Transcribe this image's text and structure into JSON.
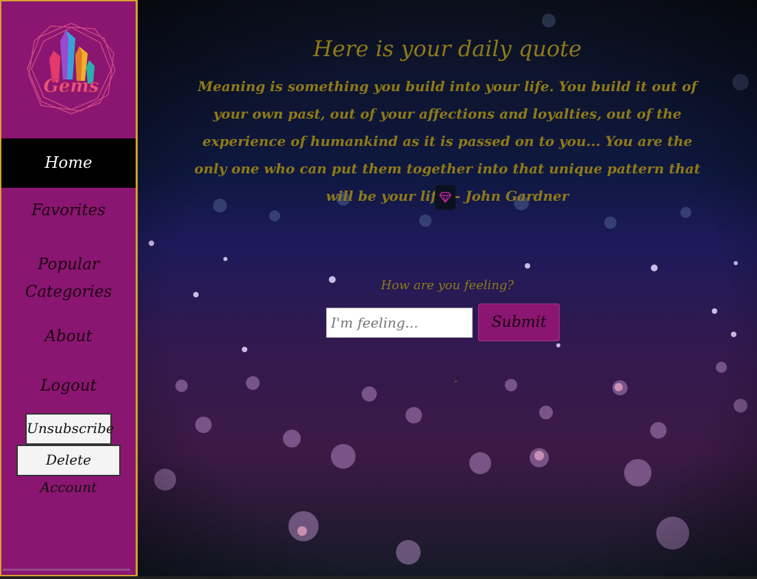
{
  "sidebar": {
    "logo_text": "Gems",
    "nav": {
      "home": "Home",
      "favorites": "Favorites",
      "popular_line1": "Popular",
      "popular_line2": "Categories",
      "about": "About",
      "logout": "Logout"
    },
    "unsubscribe_label": "Unsubscribe",
    "delete_account_label": "Delete Account"
  },
  "main": {
    "quote_title": "Here is your daily quote",
    "quote_text": "Meaning is something you build into your life. You build it out of your own past, out of your affections and loyalties, out of the experience of humankind as it is passed on to you... You are the only one who can put them together into that unique pattern that will be your life. - John Gardner",
    "favorite_icon": "gem-icon",
    "feeling_prompt": "How are you feeling?",
    "feeling_placeholder": "I'm feeling...",
    "submit_label": "Submit",
    "result_text": "-"
  },
  "colors": {
    "sidebar_bg": "#8a1671",
    "sidebar_border": "#d8a12a",
    "text_gold": "#8e7a18",
    "active_nav_bg": "#000000"
  }
}
